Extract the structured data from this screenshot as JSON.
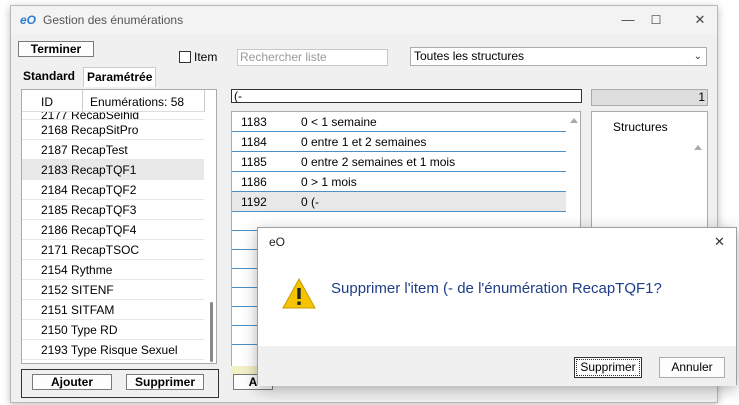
{
  "window": {
    "title": "Gestion des énumérations",
    "controls": {
      "minimize": "—",
      "maximize": "☐",
      "close": "✕"
    }
  },
  "toolbar": {
    "terminer_label": "Terminer",
    "item_checkbox_label": "Item",
    "item_checked": false,
    "search_placeholder": "Rechercher liste",
    "structure_select_value": "Toutes les structures"
  },
  "tabs": [
    {
      "label": "Standard",
      "active": false
    },
    {
      "label": "Paramétrée",
      "active": true
    }
  ],
  "enum_list": {
    "header_id": "ID",
    "header_count": "Enumérations: 58",
    "partial_row": {
      "id": "2177",
      "name": "RecapSeihig"
    },
    "rows": [
      {
        "id": "2168",
        "name": "RecapSitPro"
      },
      {
        "id": "2187",
        "name": "RecapTest"
      },
      {
        "id": "2183",
        "name": "RecapTQF1",
        "selected": true
      },
      {
        "id": "2184",
        "name": "RecapTQF2"
      },
      {
        "id": "2185",
        "name": "RecapTQF3"
      },
      {
        "id": "2186",
        "name": "RecapTQF4"
      },
      {
        "id": "2171",
        "name": "RecapTSOC"
      },
      {
        "id": "2154",
        "name": "Rythme"
      },
      {
        "id": "2152",
        "name": "SITENF"
      },
      {
        "id": "2151",
        "name": "SITFAM"
      },
      {
        "id": "2150",
        "name": "Type RD"
      },
      {
        "id": "2193",
        "name": "Type Risque Sexuel"
      }
    ],
    "add_label": "Ajouter",
    "delete_label": "Supprimer"
  },
  "items": {
    "formula_value": "(-",
    "counter": "1",
    "rows": [
      {
        "id": "1183",
        "label": "0 < 1 semaine"
      },
      {
        "id": "1184",
        "label": "0 entre 1 et 2 semaines"
      },
      {
        "id": "1185",
        "label": "0 entre 2 semaines et 1 mois"
      },
      {
        "id": "1186",
        "label": "0 > 1 mois"
      },
      {
        "id": "1192",
        "label": "0 (-",
        "selected": true
      }
    ],
    "add_label_partial": "A"
  },
  "structures": {
    "title": "Structures"
  },
  "dialog": {
    "title": "eO",
    "close": "✕",
    "icon": "warning-icon",
    "message": "Supprimer l'item (- de l'énumération RecapTQF1?",
    "ok_label": "Supprimer",
    "cancel_label": "Annuler"
  },
  "colors": {
    "accent_blue": "#1f3d87",
    "row_separator": "#4a90c8",
    "warning_yellow": "#f5c400"
  }
}
